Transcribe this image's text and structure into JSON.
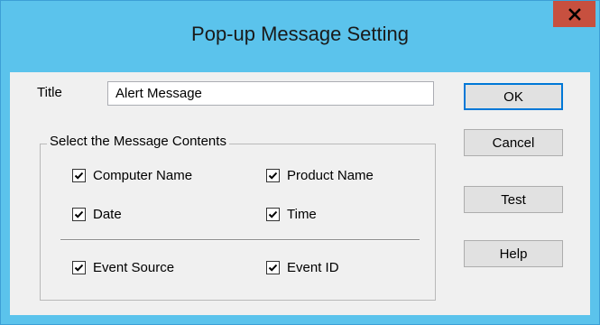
{
  "window": {
    "title": "Pop-up Message Setting",
    "close_icon": "close-icon"
  },
  "form": {
    "title_label": "Title",
    "title_value": "Alert Message"
  },
  "group": {
    "legend": "Select the Message Contents",
    "checkboxes": [
      {
        "label": "Computer Name",
        "checked": true
      },
      {
        "label": "Product Name",
        "checked": true
      },
      {
        "label": "Date",
        "checked": true
      },
      {
        "label": "Time",
        "checked": true
      },
      {
        "label": "Event Source",
        "checked": true
      },
      {
        "label": "Event ID",
        "checked": true
      }
    ]
  },
  "buttons": {
    "ok": "OK",
    "cancel": "Cancel",
    "test": "Test",
    "help": "Help"
  },
  "colors": {
    "titlebar": "#5bc3ec",
    "close_button": "#c7503f",
    "client_background": "#f0f0f0"
  }
}
